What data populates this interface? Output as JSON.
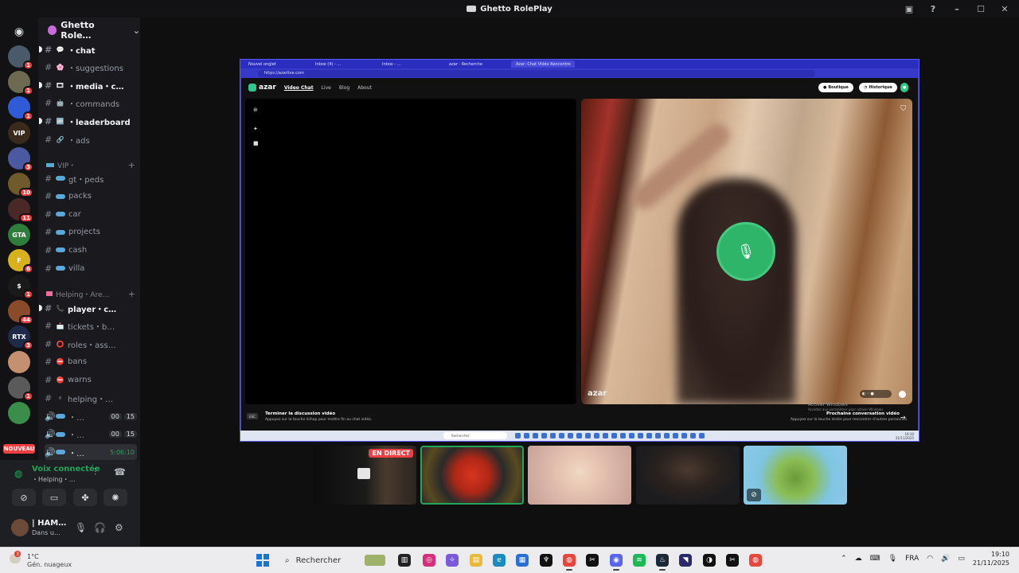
{
  "window": {
    "title": "Ghetto RolePlay"
  },
  "server": {
    "name": "Ghetto Role…"
  },
  "servers": [
    {
      "label": "",
      "badge": "1",
      "color": "#4b5a6b"
    },
    {
      "label": "",
      "badge": "1",
      "color": "#6d6a52"
    },
    {
      "label": "",
      "badge": "1",
      "color": "#2f5bd6"
    },
    {
      "label": "VIP",
      "badge": "",
      "color": "#3a2a1c"
    },
    {
      "label": "",
      "badge": "3",
      "color": "#4b5aa0"
    },
    {
      "label": "",
      "badge": "10",
      "color": "#705a2b"
    },
    {
      "label": "",
      "badge": "11",
      "color": "#4a2828"
    },
    {
      "label": "GTA",
      "badge": "",
      "color": "#2e7d3c"
    },
    {
      "label": "F",
      "badge": "6",
      "color": "#d8b21c"
    },
    {
      "label": "$",
      "badge": "1",
      "color": "#1a1a1a"
    },
    {
      "label": "",
      "badge": "44",
      "color": "#8a4b2a"
    },
    {
      "label": "RTX",
      "badge": "3",
      "color": "#1f2a4a"
    },
    {
      "label": "",
      "badge": "",
      "color": "#c59070"
    },
    {
      "label": "",
      "badge": "1",
      "color": "#5a5a5a"
    },
    {
      "label": "",
      "badge": "",
      "color": "#3a8d4a"
    }
  ],
  "new_label": "NOUVEAU",
  "channels": [
    {
      "icon": "💬",
      "name": "・chat",
      "unread": true
    },
    {
      "icon": "🌸",
      "name": "・suggestions",
      "unread": false
    },
    {
      "icon": "🎞",
      "name": "・media・c…",
      "unread": true
    },
    {
      "icon": "🤖",
      "name": "・commands",
      "unread": false
    },
    {
      "icon": "🆙",
      "name": "・leaderboard",
      "unread": true
    },
    {
      "icon": "🔗",
      "name": "・ads",
      "unread": false
    }
  ],
  "vip_category": "VIP・",
  "vip_channels": [
    {
      "name": "gt・peds"
    },
    {
      "name": "packs"
    },
    {
      "name": "car"
    },
    {
      "name": "projects"
    },
    {
      "name": "cash"
    },
    {
      "name": "villa"
    }
  ],
  "help_category": "Helping・Are…",
  "help_channels": [
    {
      "icon": "📞",
      "name": "player・c…",
      "unread": true
    },
    {
      "icon": "📩",
      "name": "tickets・b…",
      "unread": false
    },
    {
      "icon": "⭕",
      "name": "roles・ass…",
      "unread": false
    },
    {
      "icon": "⛔",
      "name": "bans",
      "unread": false
    },
    {
      "icon": "⛔",
      "name": "warns",
      "unread": false
    },
    {
      "icon": "⚡",
      "name": "helping・…",
      "unread": false
    }
  ],
  "voice_channels": [
    {
      "name": "・…",
      "c1": "00",
      "c2": "15"
    },
    {
      "name": "・…",
      "c1": "00",
      "c2": "15"
    },
    {
      "name": "・…",
      "time": "5:06:10"
    }
  ],
  "voice": {
    "status": "Voix connectée",
    "channel": "・Helping・…"
  },
  "user": {
    "name": "| HAM…",
    "status": "Dans u…"
  },
  "browser": {
    "tabs": [
      "Nouvel onglet",
      "Inbox (4) - ...",
      "Inbox - ...",
      "azar - Recherche",
      "Azar: Chat Vidéo Rencontre"
    ],
    "url": "https://azarlive.com"
  },
  "azar": {
    "logo": "azar",
    "nav": [
      "Video Chat",
      "Live",
      "Blog",
      "About"
    ],
    "boutique": "Boutique",
    "historique": "Historique",
    "end_title": "Terminer la discussion vidéo",
    "end_sub": "Appuyez sur la touche échap pour mettre fin au chat vidéo.",
    "next_title": "Prochaine conversation vidéo",
    "next_sub": "Appuyez sur la touche droite pour rencontrer d'autres personnes",
    "activate_windows": "Activer Windows",
    "activate_sub": "Accédez aux paramètres pour activer Windows.",
    "esc": "ESC",
    "inner_search": "Rechercher",
    "inner_time": "19:10",
    "inner_date": "21/11/2025"
  },
  "tiles": [
    {
      "live": "EN DIRECT"
    },
    {
      "live": ""
    },
    {
      "live": ""
    },
    {
      "live": ""
    },
    {
      "live": ""
    }
  ],
  "taskbar": {
    "temp": "1°C",
    "weather": "Gén. nuageux",
    "weather_badge": "3",
    "search_placeholder": "Rechercher",
    "lang": "FRA",
    "time": "19:10",
    "date": "21/11/2025"
  },
  "colors": {
    "accent": "#5865f2",
    "online": "#23a55a",
    "badge": "#f23f43",
    "stream_border": "#3c3ec4",
    "azar_green": "#2fb56a"
  }
}
